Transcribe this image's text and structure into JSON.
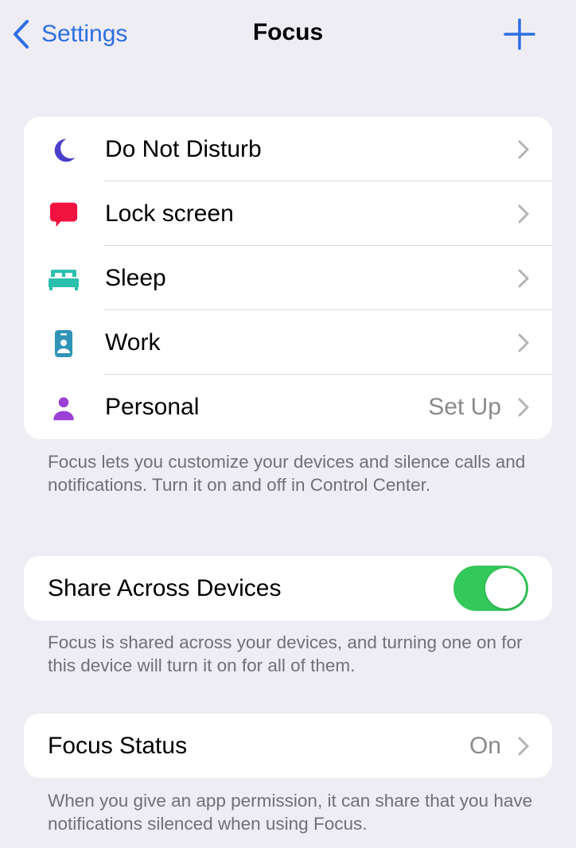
{
  "navbar": {
    "back_label": "Settings",
    "title": "Focus",
    "add_icon": "plus-icon",
    "back_icon": "chevron-left-icon"
  },
  "focus_modes": [
    {
      "label": "Do Not Disturb",
      "icon": "moon-icon",
      "color": "#4a3fcb",
      "detail": ""
    },
    {
      "label": "Lock screen",
      "icon": "speech-bubble-icon",
      "color": "#f0123f",
      "detail": ""
    },
    {
      "label": "Sleep",
      "icon": "bed-icon",
      "color": "#2bbfae",
      "detail": ""
    },
    {
      "label": "Work",
      "icon": "id-badge-icon",
      "color": "#2f94b8",
      "detail": ""
    },
    {
      "label": "Personal",
      "icon": "person-icon",
      "color": "#9b3fd6",
      "detail": "Set Up"
    }
  ],
  "focus_modes_footer": "Focus lets you customize your devices and silence calls and notifications. Turn it on and off in Control Center.",
  "share_across_devices": {
    "label": "Share Across Devices",
    "enabled": true,
    "toggle_color": "#34c759",
    "footer": "Focus is shared across your devices, and turning one on for this device will turn it on for all of them."
  },
  "focus_status": {
    "label": "Focus Status",
    "value": "On",
    "footer": "When you give an app permission, it can share that you have notifications silenced when using Focus."
  },
  "colors": {
    "accent": "#2c6fe3",
    "background": "#efedf4",
    "secondary_text": "#8a8a8e"
  }
}
